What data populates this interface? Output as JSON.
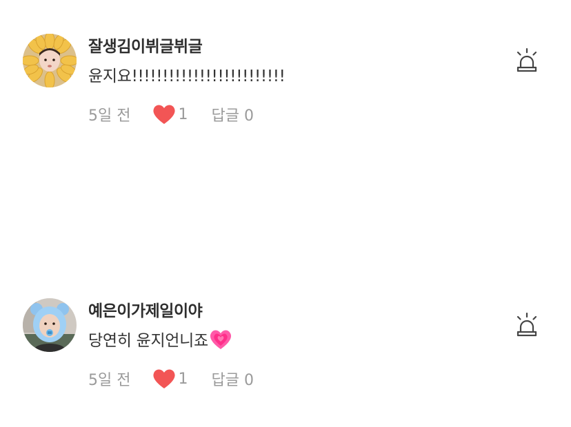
{
  "comments": [
    {
      "username": "잘생김이뷔글뷔글",
      "text": "윤지요!!!!!!!!!!!!!!!!!!!!!!!!!",
      "time": "5일 전",
      "likes": "1",
      "reply_label": "답글 0",
      "avatar": "sunflower-avatar",
      "report_icon": "siren-report-icon"
    },
    {
      "username": "예은이가제일이야",
      "text": "당연히 윤지언니죠",
      "text_emoji": "growing-heart-emoji",
      "time": "5일 전",
      "likes": "1",
      "reply_label": "답글 0",
      "avatar": "blue-bear-hat-avatar",
      "report_icon": "siren-report-icon"
    }
  ],
  "colors": {
    "like_heart": "#f25555",
    "meta_text": "#9a9a9a",
    "username": "#2e2e2e",
    "emoji_heart": "#ff4fa0"
  }
}
